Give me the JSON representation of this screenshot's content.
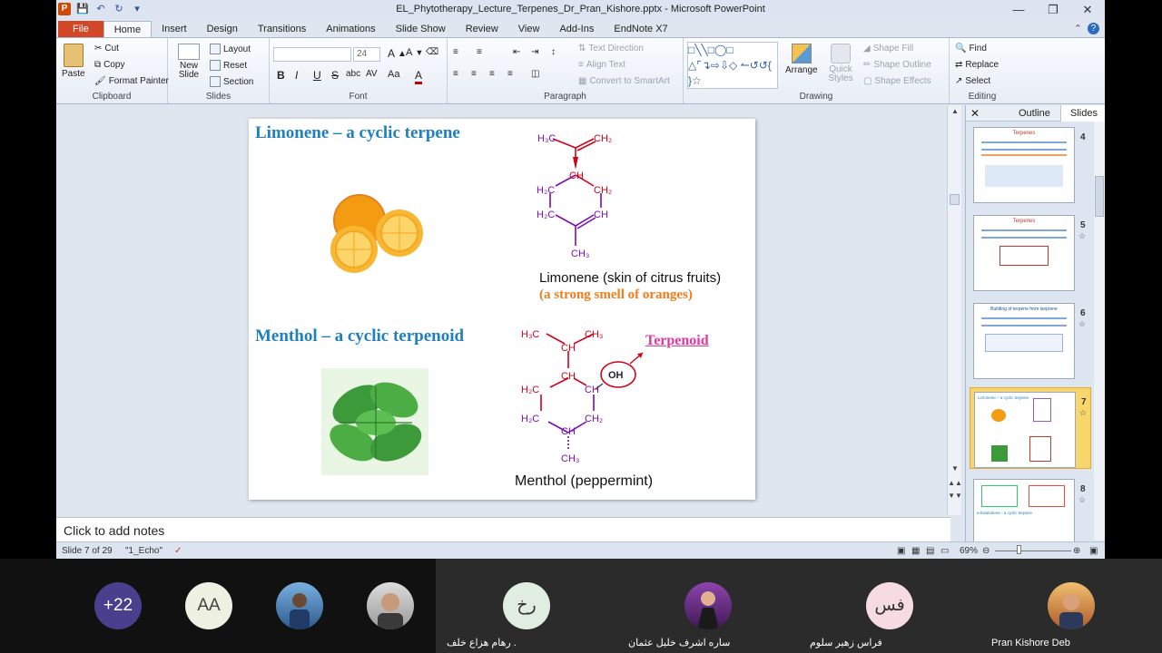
{
  "window": {
    "title": "EL_Phytotherapy_Lecture_Terpenes_Dr_Pran_Kishore.pptx - Microsoft PowerPoint",
    "controls": [
      "—",
      "❐",
      "✕"
    ]
  },
  "tabs": [
    "File",
    "Home",
    "Insert",
    "Design",
    "Transitions",
    "Animations",
    "Slide Show",
    "Review",
    "View",
    "Add-Ins",
    "EndNote X7"
  ],
  "ribbon": {
    "clipboard": {
      "label": "Clipboard",
      "paste": "Paste",
      "cut": "Cut",
      "copy": "Copy",
      "format_painter": "Format Painter"
    },
    "slides": {
      "label": "Slides",
      "new_slide": "New Slide",
      "layout": "Layout",
      "reset": "Reset",
      "section": "Section"
    },
    "font": {
      "label": "Font",
      "size": "24",
      "bold": "B",
      "italic": "I",
      "underline": "U",
      "strike": "S",
      "shadow": "abc",
      "spacing": "AV",
      "case": "Aa",
      "color": "A"
    },
    "paragraph": {
      "label": "Paragraph",
      "text_direction": "Text Direction",
      "align_text": "Align Text",
      "convert": "Convert to SmartArt"
    },
    "drawing": {
      "label": "Drawing",
      "arrange": "Arrange",
      "quick_styles": "Quick Styles",
      "shape_fill": "Shape Fill",
      "shape_outline": "Shape Outline",
      "shape_effects": "Shape Effects"
    },
    "editing": {
      "label": "Editing",
      "find": "Find",
      "replace": "Replace",
      "select": "Select"
    }
  },
  "slide": {
    "title1": "Limonene – a cyclic terpene",
    "title2": "Menthol – a cyclic terpenoid",
    "limonene_caption": "Limonene",
    "limonene_caption_rest": " (skin of citrus fruits)",
    "limonene_smell": "(a strong smell of oranges)",
    "terpenoid_label": "Terpenoid",
    "menthol_caption": "Menthol (peppermint)",
    "limonene_labels": [
      "H₃C",
      "CH₂",
      "CH",
      "H₂C",
      "CH₂",
      "H₂C",
      "CH",
      "CH₃"
    ],
    "menthol_labels": [
      "H₃C",
      "CH",
      "CH₃",
      "CH",
      "H₂C",
      "CH",
      "H₂C",
      "CH₂",
      "CH",
      "CH₃",
      "OH"
    ]
  },
  "notes": {
    "placeholder": "Click to add notes"
  },
  "status": {
    "slide": "Slide 7 of 29",
    "theme": "\"1_Echo\"",
    "zoom": "69%"
  },
  "panel": {
    "close": "✕",
    "tabs": [
      "Outline",
      "Slides"
    ],
    "thumbs": [
      {
        "num": "4",
        "title": "Terpenes"
      },
      {
        "num": "5",
        "title": "Terpenes"
      },
      {
        "num": "6",
        "title": "Building of terpene from isoprene"
      },
      {
        "num": "7",
        "title": "Limonene – a cyclic terpene",
        "selected": true
      },
      {
        "num": "8",
        "title": "a-bisabolene - a cyclic terpene"
      }
    ]
  },
  "meeting": {
    "participants": [
      {
        "initials": "+22",
        "name": ""
      },
      {
        "initials": "AA",
        "name": ""
      },
      {
        "initials": "",
        "name": ""
      },
      {
        "initials": "",
        "name": ""
      },
      {
        "initials": "رخ",
        "name": "رهام هزاع خلف ."
      },
      {
        "initials": "",
        "name": "ساره اشرف خليل عثمان"
      },
      {
        "initials": "فس",
        "name": "فراس زهير سلوم"
      },
      {
        "initials": "",
        "name": "Pran Kishore Deb"
      }
    ]
  }
}
